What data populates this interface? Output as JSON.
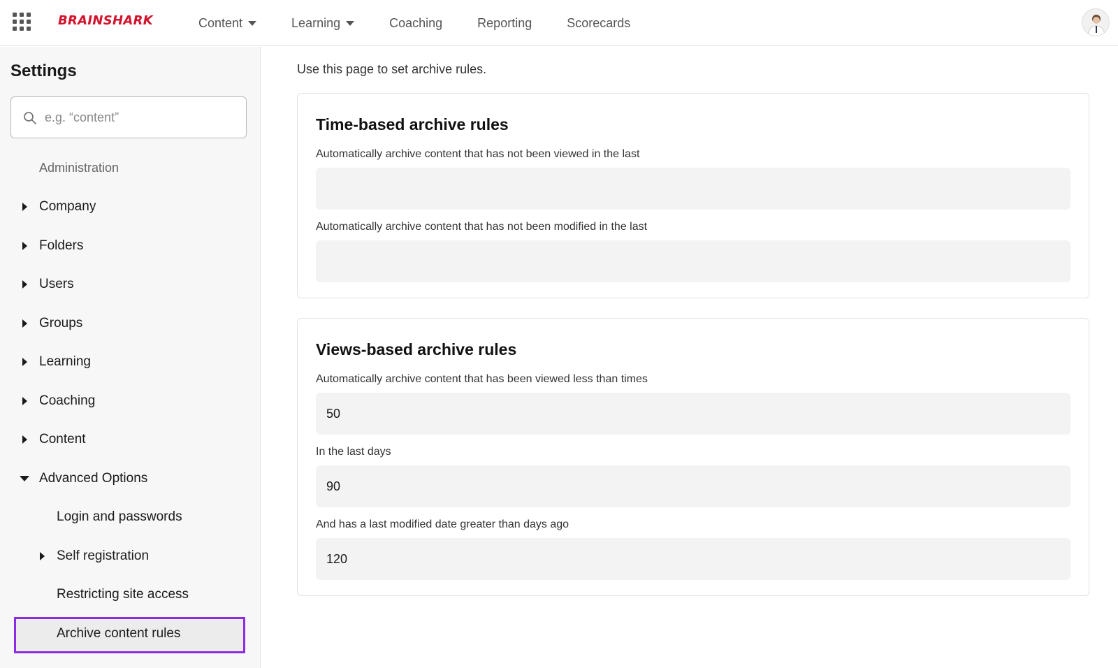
{
  "header": {
    "logo_text": "BRAINSHARK",
    "nav": [
      {
        "label": "Content"
      },
      {
        "label": "Learning"
      },
      {
        "label": "Coaching"
      },
      {
        "label": "Reporting"
      },
      {
        "label": "Scorecards"
      }
    ],
    "accent_color": "#d3122b"
  },
  "sidebar": {
    "title": "Settings",
    "search_placeholder": "e.g. “content”",
    "section_label": "Administration",
    "items": [
      {
        "label": "Company"
      },
      {
        "label": "Folders"
      },
      {
        "label": "Users"
      },
      {
        "label": "Groups"
      },
      {
        "label": "Learning"
      },
      {
        "label": "Coaching"
      },
      {
        "label": "Content"
      },
      {
        "label": "Advanced Options"
      }
    ],
    "subitems": [
      {
        "label": "Login and passwords"
      },
      {
        "label": "Self registration"
      },
      {
        "label": "Restricting site access"
      },
      {
        "label": "Archive content rules"
      }
    ],
    "active_highlight_color": "#8b2be2"
  },
  "main": {
    "intro": "Use this page to set archive rules.",
    "time_card": {
      "title": "Time-based archive rules",
      "viewed_label": "Automatically archive content that has not been viewed in the last",
      "viewed_value": "",
      "modified_label": "Automatically archive content that has not been modified in the last",
      "modified_value": ""
    },
    "views_card": {
      "title": "Views-based archive rules",
      "views_label": "Automatically archive content that has been viewed less than times",
      "views_value": "50",
      "days_label": "In the last days",
      "days_value": "90",
      "modified_label": "And has a last modified date greater than days ago",
      "modified_value": "120"
    }
  }
}
